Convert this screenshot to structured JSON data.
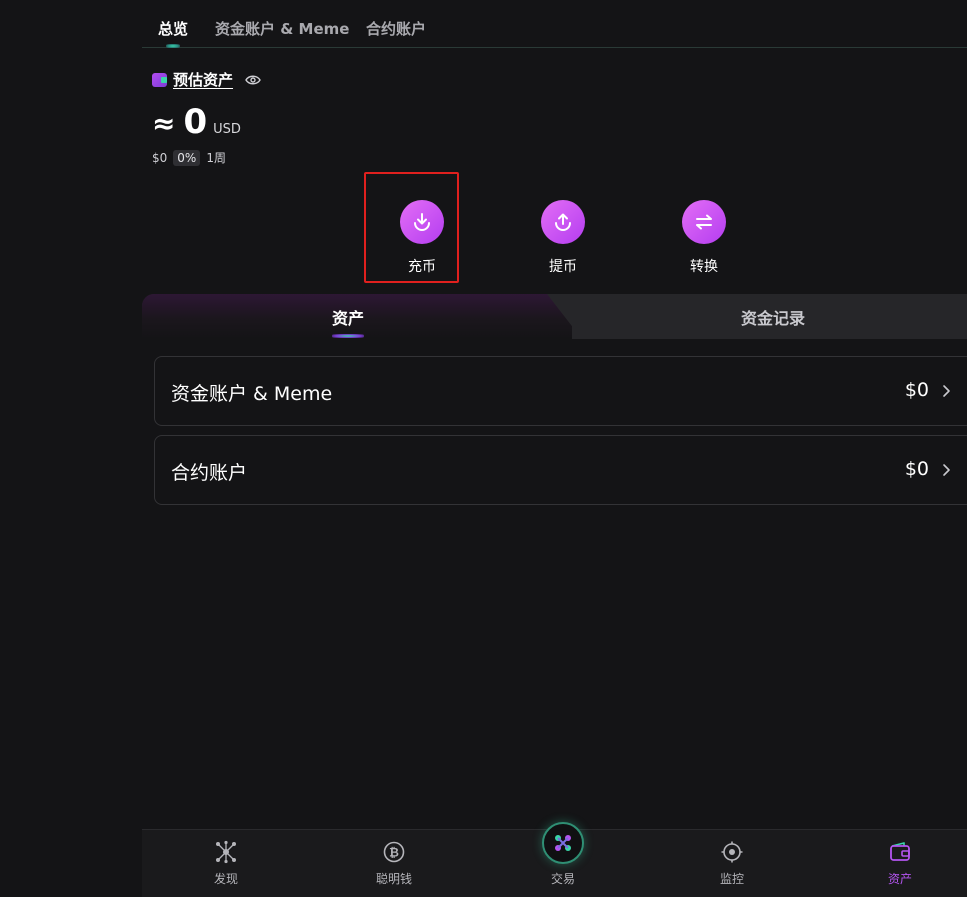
{
  "top_tabs": [
    {
      "label": "总览",
      "active": true
    },
    {
      "label": "资金账户 & Meme",
      "active": false
    },
    {
      "label": "合约账户",
      "active": false
    }
  ],
  "estimate": {
    "title": "预估资产",
    "approx": "≈",
    "balance": "0",
    "currency": "USD",
    "change_amount": "$0",
    "change_pct": "0%",
    "period": "1周"
  },
  "actions": [
    {
      "label": "充币",
      "icon": "deposit-icon"
    },
    {
      "label": "提币",
      "icon": "withdraw-icon"
    },
    {
      "label": "转换",
      "icon": "transfer-icon"
    }
  ],
  "sub_tabs": [
    {
      "label": "资产",
      "active": true
    },
    {
      "label": "资金记录",
      "active": false
    }
  ],
  "accounts": [
    {
      "name": "资金账户 & Meme",
      "amount": "$0"
    },
    {
      "name": "合约账户",
      "amount": "$0"
    }
  ],
  "bottom_nav": [
    {
      "label": "发现",
      "icon": "discover-icon",
      "active": false
    },
    {
      "label": "聪明钱",
      "icon": "bitcoin-icon",
      "active": false
    },
    {
      "label": "交易",
      "icon": "trade-icon",
      "active": false
    },
    {
      "label": "监控",
      "icon": "monitor-icon",
      "active": false
    },
    {
      "label": "资产",
      "icon": "wallet-icon",
      "active": true
    }
  ],
  "colors": {
    "accent_purple": "#c04ff2",
    "accent_green": "#3ad6a8",
    "highlight_red": "#e0201e",
    "background": "#141416"
  }
}
